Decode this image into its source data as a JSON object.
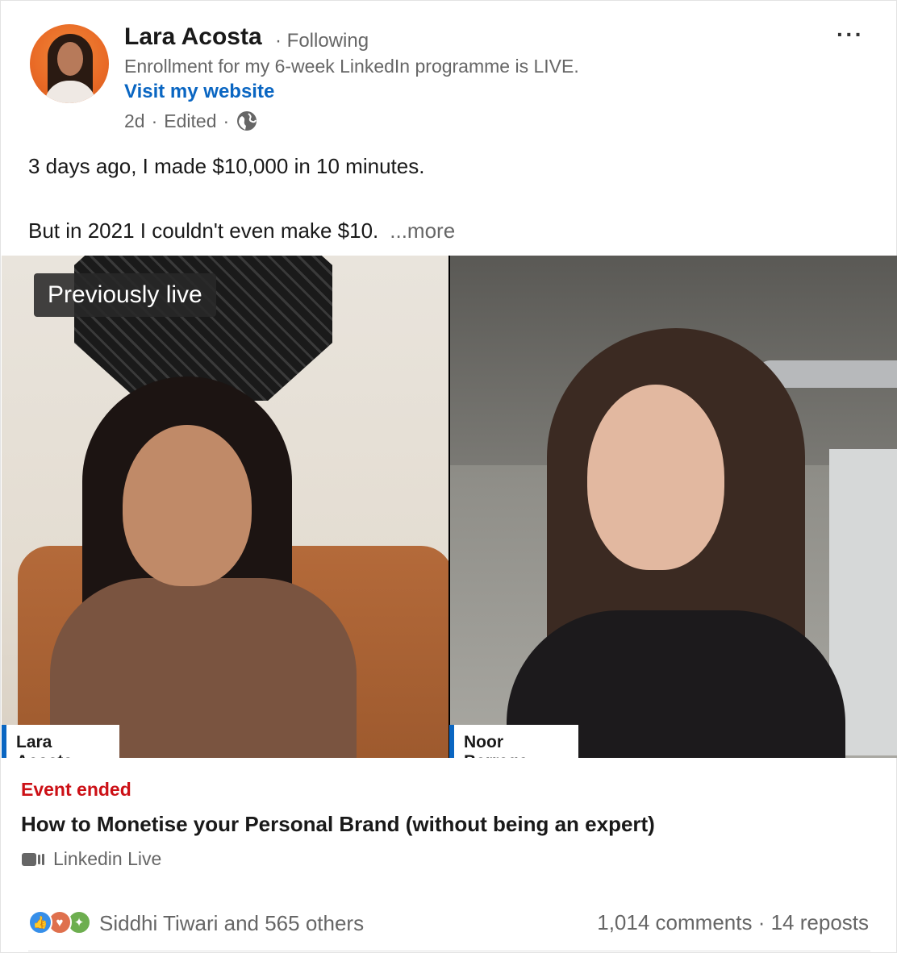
{
  "author": {
    "name": "Lara Acosta",
    "following": "· Following",
    "headline": "Enrollment for my 6-week LinkedIn programme is LIVE.",
    "website_link": "Visit my website",
    "time": "2d",
    "edited": "Edited"
  },
  "post": {
    "line1": "3 days ago, I made $10,000 in 10 minutes.",
    "line2": "But in 2021 I couldn't even make $10.",
    "see_more": "...more"
  },
  "video": {
    "badge": "Previously live",
    "left_participant": "Lara Acosta",
    "right_participant": "Noor Barrage"
  },
  "event": {
    "status": "Event ended",
    "title": "How to Monetise your Personal Brand (without being an expert)",
    "type": "Linkedin Live"
  },
  "social": {
    "reactors": "Siddhi Tiwari and 565 others",
    "comments": "1,014 comments",
    "reposts": "14 reposts"
  },
  "colors": {
    "link": "#0a66c2",
    "event_ended": "#cc1016",
    "like": "#378fe9",
    "love": "#df704d",
    "celebrate": "#6dae4f"
  },
  "icons": [
    "more-icon",
    "globe-icon",
    "video-camera-icon",
    "like-reaction-icon",
    "love-reaction-icon",
    "celebrate-reaction-icon"
  ]
}
